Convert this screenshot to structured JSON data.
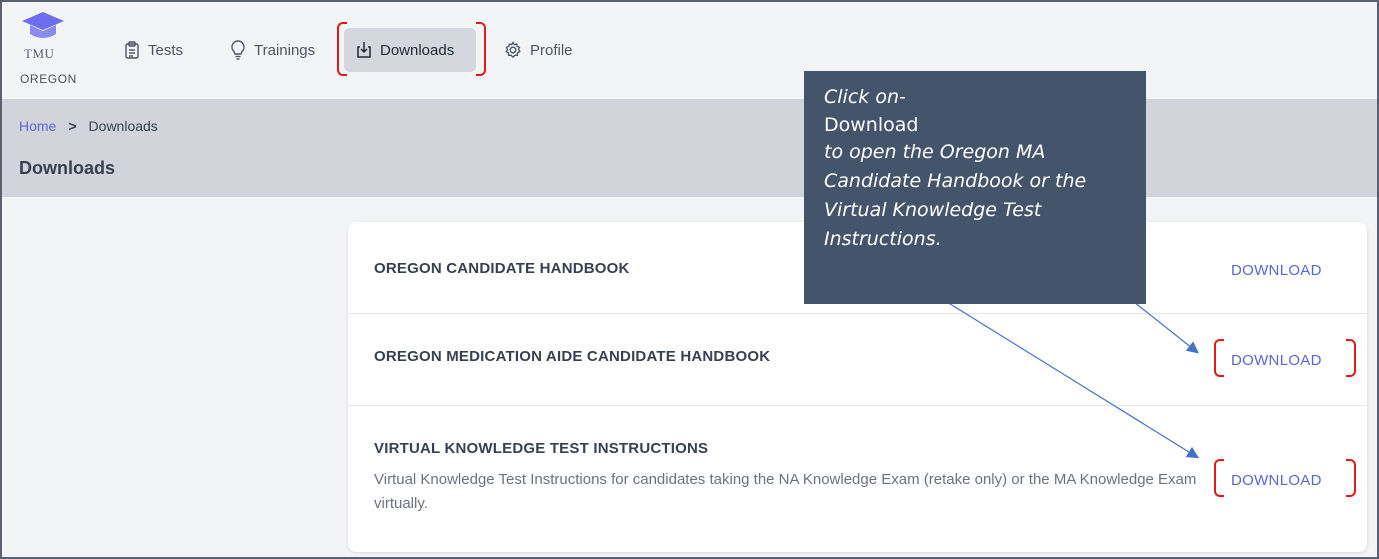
{
  "nav": {
    "logo_text": "TMU",
    "state": "OREGON",
    "items": [
      {
        "label": "Tests",
        "icon": "clipboard-icon"
      },
      {
        "label": "Trainings",
        "icon": "lightbulb-icon"
      },
      {
        "label": "Downloads",
        "icon": "download-tray-icon",
        "active": true
      },
      {
        "label": "Profile",
        "icon": "gear-icon"
      }
    ]
  },
  "breadcrumb": {
    "home": "Home",
    "separator": ">",
    "current": "Downloads"
  },
  "page_title": "Downloads",
  "downloads": [
    {
      "title": "OREGON CANDIDATE HANDBOOK",
      "action": "DOWNLOAD"
    },
    {
      "title": "OREGON MEDICATION AIDE CANDIDATE HANDBOOK",
      "action": "DOWNLOAD"
    },
    {
      "title": "VIRTUAL KNOWLEDGE TEST INSTRUCTIONS",
      "description": "Virtual Knowledge Test Instructions for candidates taking the NA Knowledge Exam (retake only) or the MA Knowledge Exam virtually.",
      "action": "DOWNLOAD"
    }
  ],
  "callout": {
    "line1": "Click on-",
    "line2": "Download",
    "line3": "to open the Oregon MA Candidate Handbook or the Virtual Knowledge Test Instructions."
  },
  "colors": {
    "accent": "#5b67d8",
    "highlight": "#e01b1b",
    "callout_bg": "#44546a",
    "logo": "#6d6df0"
  }
}
